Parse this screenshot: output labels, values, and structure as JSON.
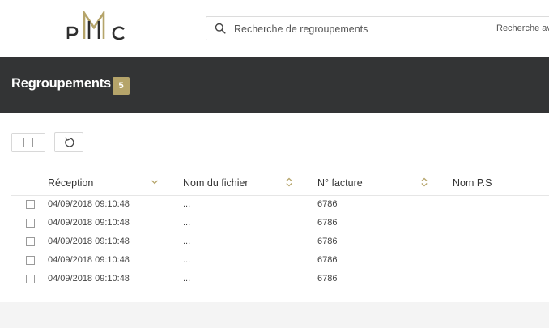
{
  "header": {
    "logo_text": "PMC",
    "search_placeholder": "Recherche de regroupements",
    "search_advanced_label": "Recherche avancée",
    "colors": {
      "band": "#333435",
      "badge": "#b5a46a",
      "footer": "#f4f4f4"
    }
  },
  "page": {
    "title": "Regroupements",
    "count": "5"
  },
  "toolbar": {
    "select_all_icon": "checkbox-icon",
    "refresh_icon": "refresh-icon"
  },
  "table": {
    "columns": [
      {
        "label": "Réception",
        "sort_icon": "chevron-down-icon"
      },
      {
        "label": "Nom du fichier",
        "sort_icon": "sort-both-icon"
      },
      {
        "label": "N° facture",
        "sort_icon": "sort-both-icon"
      },
      {
        "label": "Nom P.S"
      }
    ],
    "rows": [
      {
        "reception": "04/09/2018 09:10:48",
        "file": "...",
        "invoice": "6786",
        "ps": ""
      },
      {
        "reception": "04/09/2018 09:10:48",
        "file": "...",
        "invoice": "6786",
        "ps": ""
      },
      {
        "reception": "04/09/2018 09:10:48",
        "file": "...",
        "invoice": "6786",
        "ps": ""
      },
      {
        "reception": "04/09/2018 09:10:48",
        "file": "...",
        "invoice": "6786",
        "ps": ""
      },
      {
        "reception": "04/09/2018 09:10:48",
        "file": "...",
        "invoice": "6786",
        "ps": ""
      }
    ]
  }
}
